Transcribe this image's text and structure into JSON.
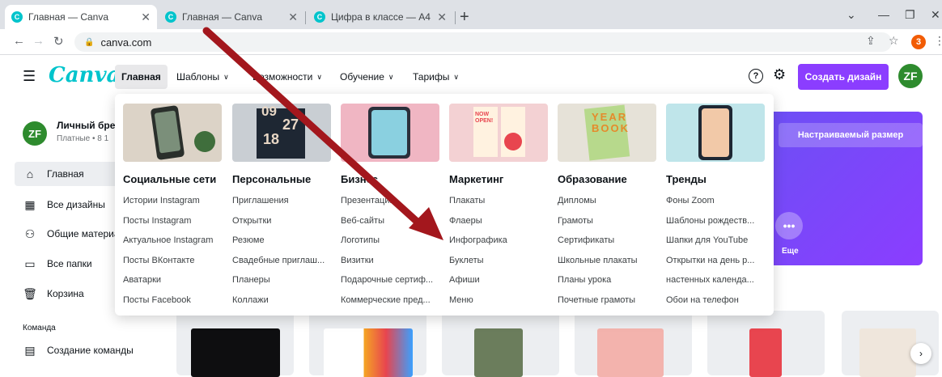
{
  "browser": {
    "tabs": [
      {
        "title": "Главная — Canva",
        "active": true
      },
      {
        "title": "Главная — Canva",
        "active": false
      },
      {
        "title": "Цифра в классе — A4",
        "active": false
      }
    ],
    "url": "canva.com",
    "extension_badge": "3"
  },
  "header": {
    "logo": "Canva",
    "nav": [
      "Главная",
      "Шаблоны",
      "Возможности",
      "Обучение",
      "Тарифы"
    ],
    "create_button": "Создать дизайн",
    "avatar_initials": "ZF",
    "help_symbol": "?"
  },
  "sidebar": {
    "avatar_initials": "ZF",
    "account_name": "Личный брен",
    "account_plan": "Платные • 8 1",
    "items": [
      "Главная",
      "Все дизайны",
      "Общие материалы",
      "Все папки",
      "Корзина"
    ],
    "team_label": "Команда",
    "team_item": "Создание команды"
  },
  "banner": {
    "custom_size_button": "Настраиваемый размер",
    "more_label": "Еще"
  },
  "dropdown": {
    "columns": [
      {
        "title": "Социальные сети",
        "links": [
          "Истории Instagram",
          "Посты Instagram",
          "Актуальное Instagram",
          "Посты ВКонтакте",
          "Аватарки",
          "Посты Facebook"
        ]
      },
      {
        "title": "Персональные",
        "links": [
          "Приглашения",
          "Открытки",
          "Резюме",
          "Свадебные приглаш...",
          "Планеры",
          "Коллажи"
        ]
      },
      {
        "title": "Бизнес",
        "links": [
          "Презентации",
          "Веб-сайты",
          "Логотипы",
          "Визитки",
          "Подарочные сертиф...",
          "Коммерческие пред..."
        ]
      },
      {
        "title": "Маркетинг",
        "links": [
          "Плакаты",
          "Флаеры",
          "Инфографика",
          "Буклеты",
          "Афиши",
          "Меню"
        ]
      },
      {
        "title": "Образование",
        "links": [
          "Дипломы",
          "Грамоты",
          "Сертификаты",
          "Школьные плакаты",
          "Планы урока",
          "Почетные грамоты"
        ]
      },
      {
        "title": "Тренды",
        "links": [
          "Фоны Zoom",
          "Шаблоны рождеств...",
          "Шапки для YouTube",
          "Открытки на день р...",
          "настенных календа...",
          "Обои на телефон"
        ]
      }
    ],
    "thumb_texts": {
      "personal_top": "09",
      "personal_mid": "27",
      "personal_bottom": "18",
      "marketing": "NOW OPEN!",
      "education": "YEAR BOOK"
    }
  },
  "colors": {
    "brand": "#00c4cc",
    "primary": "#8b3dff",
    "arrow": "#a3171d"
  }
}
